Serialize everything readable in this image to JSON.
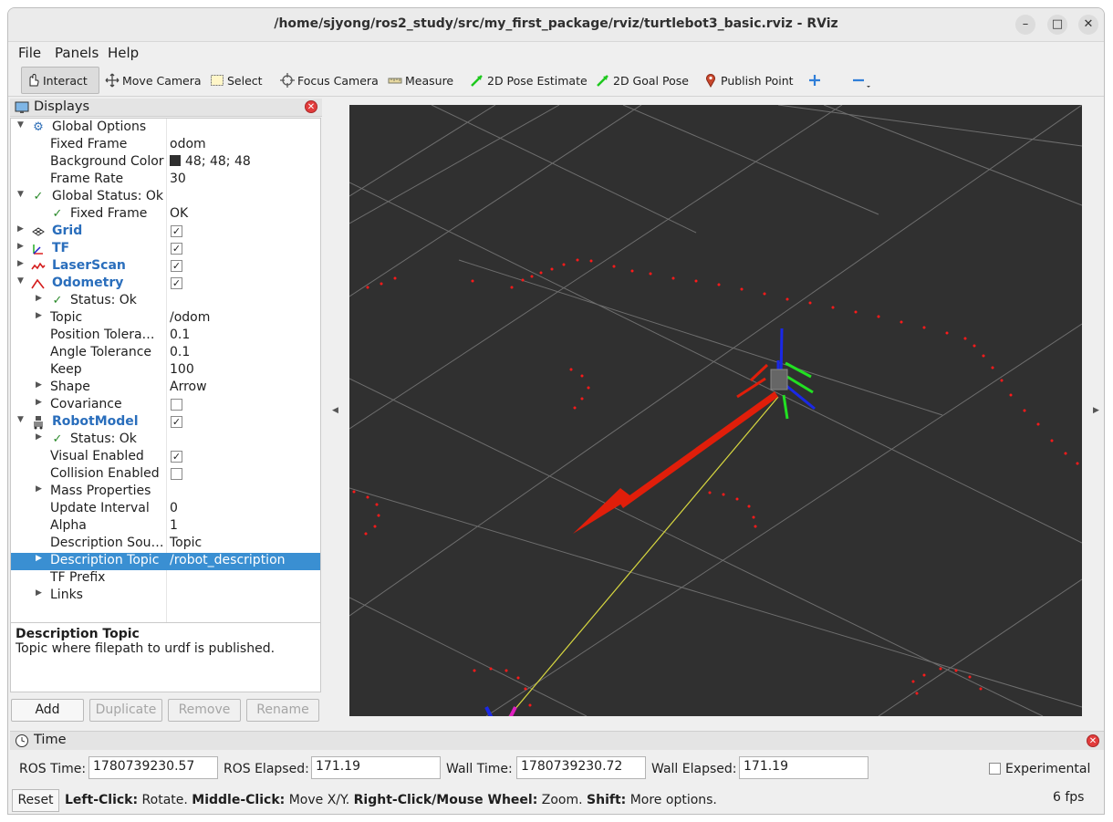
{
  "window": {
    "title": "/home/sjyong/ros2_study/src/my_first_package/rviz/turtlebot3_basic.rviz - RViz",
    "minimize_glyph": "–",
    "maximize_glyph": "□",
    "close_glyph": "✕"
  },
  "menu": {
    "file": "File",
    "panels": "Panels",
    "help": "Help"
  },
  "toolbar": {
    "interact": "Interact",
    "move_camera": "Move Camera",
    "select": "Select",
    "focus_camera": "Focus Camera",
    "measure": "Measure",
    "pose_estimate": "2D Pose Estimate",
    "goal_pose": "2D Goal Pose",
    "publish_point": "Publish Point"
  },
  "displays": {
    "title": "Displays",
    "rows": {
      "global_options": "Global Options",
      "fixed_frame": "Fixed Frame",
      "fixed_frame_val": "odom",
      "background_color": "Background Color",
      "background_color_val": "48; 48; 48",
      "frame_rate": "Frame Rate",
      "frame_rate_val": "30",
      "global_status": "Global Status: Ok",
      "fixed_frame_status": "Fixed Frame",
      "fixed_frame_status_val": "OK",
      "grid": "Grid",
      "tf": "TF",
      "laserscan": "LaserScan",
      "odometry": "Odometry",
      "odom_status": "Status: Ok",
      "topic": "Topic",
      "topic_val": "/odom",
      "position_tolerance": "Position Tolera…",
      "position_tolerance_val": "0.1",
      "angle_tolerance": "Angle Tolerance",
      "angle_tolerance_val": "0.1",
      "keep": "Keep",
      "keep_val": "100",
      "shape": "Shape",
      "shape_val": "Arrow",
      "covariance": "Covariance",
      "robotmodel": "RobotModel",
      "robot_status": "Status: Ok",
      "visual_enabled": "Visual Enabled",
      "collision_enabled": "Collision Enabled",
      "mass_properties": "Mass Properties",
      "update_interval": "Update Interval",
      "update_interval_val": "0",
      "alpha": "Alpha",
      "alpha_val": "1",
      "description_source": "Description Sou…",
      "description_source_val": "Topic",
      "description_topic": "Description Topic",
      "description_topic_val": "/robot_description",
      "tf_prefix": "TF Prefix",
      "links": "Links"
    },
    "checkboxes": {
      "grid": true,
      "tf": true,
      "laserscan": true,
      "odometry": true,
      "covariance": false,
      "robotmodel": true,
      "visual_enabled": true,
      "collision_enabled": false
    }
  },
  "description": {
    "title": "Description Topic",
    "text": "Topic where filepath to urdf is published."
  },
  "buttons": {
    "add": "Add",
    "duplicate": "Duplicate",
    "remove": "Remove",
    "rename": "Rename"
  },
  "time": {
    "title": "Time",
    "ros_time_label": "ROS Time:",
    "ros_time": "1780739230.57",
    "ros_elapsed_label": "ROS Elapsed:",
    "ros_elapsed": "171.19",
    "wall_time_label": "Wall Time:",
    "wall_time": "1780739230.72",
    "wall_elapsed_label": "Wall Elapsed:",
    "wall_elapsed": "171.19",
    "experimental": "Experimental"
  },
  "status": {
    "reset": "Reset",
    "k1": "Left-Click:",
    "v1": " Rotate. ",
    "k2": "Middle-Click:",
    "v2": " Move X/Y. ",
    "k3": "Right-Click/Mouse Wheel:",
    "v3": " Zoom. ",
    "k4": "Shift:",
    "v4": " More options.",
    "fps": "6 fps"
  },
  "colors": {
    "viewport_bg": "#303030",
    "selection": "#3a8fd2",
    "display_name": "#2a6ebc",
    "laser": "#ff1a1a",
    "arrow": "#e01e0a"
  }
}
